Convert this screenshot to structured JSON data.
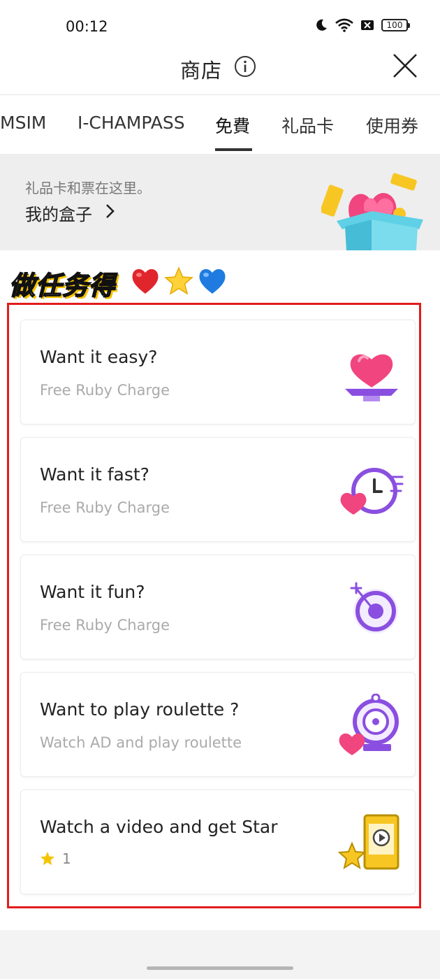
{
  "status_bar": {
    "time": "00:12",
    "battery": "100"
  },
  "header": {
    "title": "商店"
  },
  "tabs": [
    {
      "label": "MSIM",
      "active": false
    },
    {
      "label": "I-CHAMPASS",
      "active": false
    },
    {
      "label": "免費",
      "active": true
    },
    {
      "label": "礼品卡",
      "active": false
    },
    {
      "label": "使用券",
      "active": false
    }
  ],
  "banner": {
    "subtitle": "礼品卡和票在这里。",
    "link_label": "我的盒子"
  },
  "section": {
    "title": "做任务得"
  },
  "cards": [
    {
      "title": "Want it easy?",
      "subtitle": "Free Ruby Charge",
      "icon": "heart-tray-icon"
    },
    {
      "title": "Want it fast?",
      "subtitle": "Free Ruby Charge",
      "icon": "speed-clock-icon"
    },
    {
      "title": "Want it fun?",
      "subtitle": "Free Ruby Charge",
      "icon": "target-icon"
    },
    {
      "title": "Want to play roulette ?",
      "subtitle": "Watch AD and play roulette",
      "icon": "roulette-icon"
    },
    {
      "title": "Watch a video and get Star",
      "star_count": "1",
      "icon": "video-star-icon"
    }
  ],
  "colors": {
    "accent_purple": "#8a4fe0",
    "pink": "#f0457f",
    "highlight_red": "#e21b1b",
    "star_yellow": "#f5c400"
  }
}
